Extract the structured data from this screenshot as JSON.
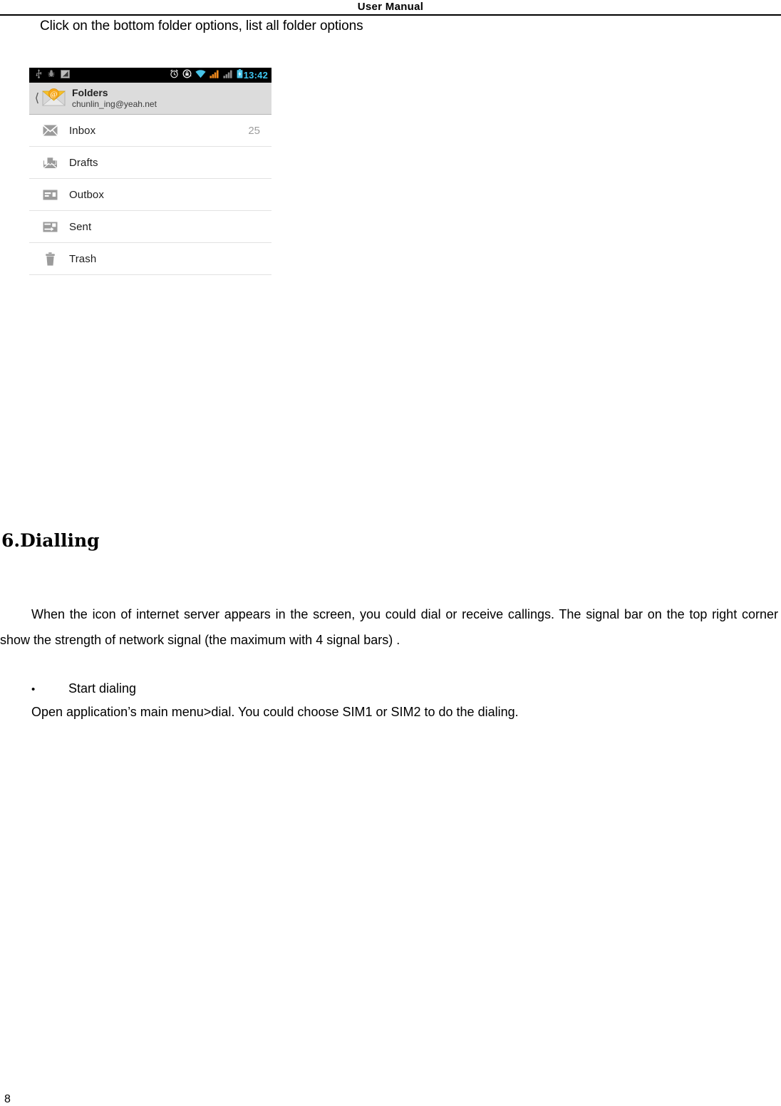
{
  "header": {
    "title": "User    Manual"
  },
  "caption": "Click on the bottom folder options, list all folder options",
  "screenshot": {
    "status_bar": {
      "left_icons": [
        "usb-icon",
        "debug-bug-icon",
        "screenshot-icon"
      ],
      "right_icons": [
        "alarm-clock-icon",
        "rotation-lock-icon",
        "wifi-icon",
        "signal-sim1-icon",
        "signal-sim2-icon",
        "battery-charging-icon"
      ],
      "clock": "13:42",
      "clock_color": "#3ec6f0",
      "background": "#000000"
    },
    "account_header": {
      "back_icon": "back-chevron-icon",
      "mail_icon": "email-at-icon",
      "title": "Folders",
      "account": "chunlin_ing@yeah.net",
      "background": "#dcdcdc"
    },
    "folders": [
      {
        "icon": "inbox-envelope-icon",
        "label": "Inbox",
        "count": "25"
      },
      {
        "icon": "drafts-icon",
        "label": "Drafts",
        "count": ""
      },
      {
        "icon": "outbox-icon",
        "label": "Outbox",
        "count": ""
      },
      {
        "icon": "sent-icon",
        "label": "Sent",
        "count": ""
      },
      {
        "icon": "trash-icon",
        "label": "Trash",
        "count": ""
      }
    ]
  },
  "section": {
    "heading": "6.Dialling",
    "paragraph": "When the icon of internet server appears in the screen, you could dial or receive callings. The signal bar on the top right corner show the strength of network signal (the maximum with 4 signal bars) .",
    "bullet_marker": "•",
    "bullet_label": "Start dialing",
    "bullet_body": "Open application’s main menu>dial. You could choose SIM1 or SIM2 to do the dialing."
  },
  "footer": {
    "page_number": "8"
  }
}
